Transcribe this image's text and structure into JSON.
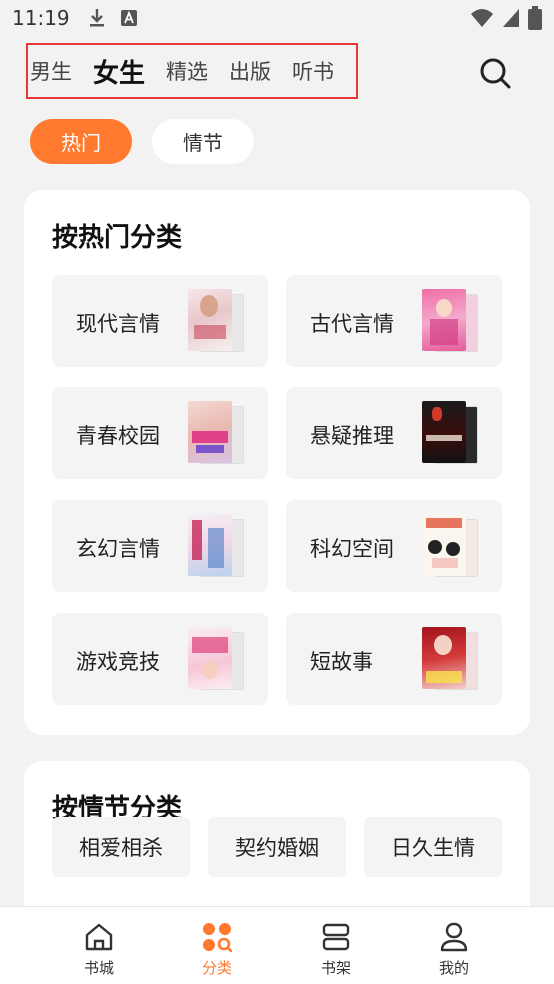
{
  "status": {
    "time": "11:19"
  },
  "top_tabs": [
    {
      "label": "男生",
      "active": false
    },
    {
      "label": "女生",
      "active": true
    },
    {
      "label": "精选",
      "active": false
    },
    {
      "label": "出版",
      "active": false
    },
    {
      "label": "听书",
      "active": false
    }
  ],
  "filters": {
    "hot": "热门",
    "plot": "情节",
    "selected": "热门"
  },
  "hot_section": {
    "title": "按热门分类",
    "items": [
      {
        "label": "现代言情"
      },
      {
        "label": "古代言情"
      },
      {
        "label": "青春校园"
      },
      {
        "label": "悬疑推理"
      },
      {
        "label": "玄幻言情"
      },
      {
        "label": "科幻空间"
      },
      {
        "label": "游戏竞技"
      },
      {
        "label": "短故事"
      }
    ]
  },
  "plot_section": {
    "title": "按情节分类",
    "tags": [
      "相爱相杀",
      "契约婚姻",
      "日久生情"
    ]
  },
  "bottom_nav": [
    {
      "label": "书城",
      "icon": "home-icon",
      "active": false
    },
    {
      "label": "分类",
      "icon": "category-icon",
      "active": true
    },
    {
      "label": "书架",
      "icon": "bookshelf-icon",
      "active": false
    },
    {
      "label": "我的",
      "icon": "profile-icon",
      "active": false
    }
  ],
  "colors": {
    "accent": "#ff7a2f",
    "highlight_box": "#e53935"
  }
}
